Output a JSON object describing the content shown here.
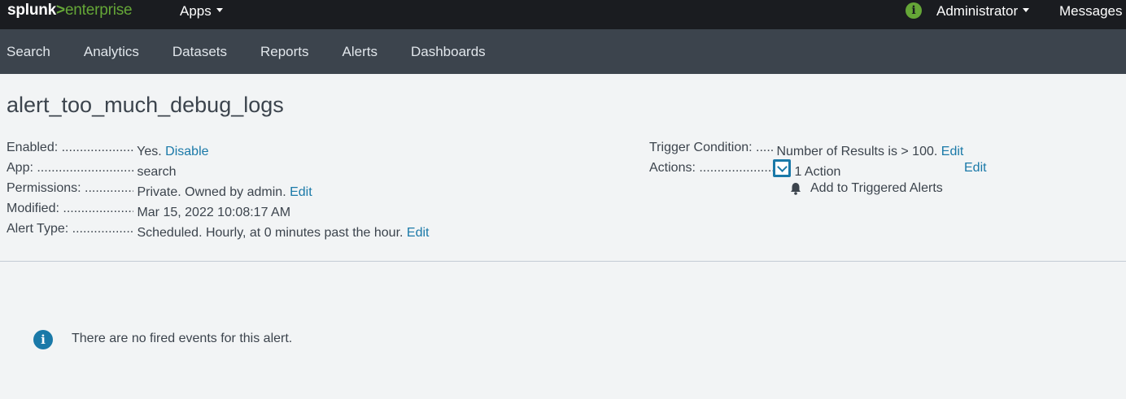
{
  "header": {
    "logo_brand": "splunk",
    "logo_gt": ">",
    "logo_product": "enterprise",
    "apps_label": "Apps",
    "user_label": "Administrator",
    "messages_label": "Messages",
    "status_icon": "i"
  },
  "nav": {
    "items": [
      "Search",
      "Analytics",
      "Datasets",
      "Reports",
      "Alerts",
      "Dashboards"
    ]
  },
  "alert": {
    "name": "alert_too_much_debug_logs",
    "details": [
      {
        "key": "Enabled: ........................................",
        "value": "Yes.",
        "link": "Disable"
      },
      {
        "key": "App: ..................................................",
        "value": "search",
        "link": ""
      },
      {
        "key": "Permissions: ........................................",
        "value": "Private. Owned by admin.",
        "link": "Edit"
      },
      {
        "key": "Modified: ........................................",
        "value": "Mar 15, 2022 10:08:17 AM",
        "link": ""
      },
      {
        "key": "Alert Type: ........................................",
        "value": "Scheduled. Hourly, at 0 minutes past the hour.",
        "link": "Edit"
      }
    ],
    "trigger_key": "Trigger Condition: ........................",
    "trigger_value": "Number of Results is > 100.",
    "trigger_link": "Edit",
    "actions_key": "Actions: ........................................",
    "actions_value": "1 Action",
    "actions_link": "Edit",
    "action_item": "Add to Triggered Alerts"
  },
  "events": {
    "info_icon": "i",
    "empty_message": "There are no fired events for this alert."
  },
  "colors": {
    "topbar": "#1a1c20",
    "appbar": "#3c444d",
    "accent_green": "#65a637",
    "link_blue": "#1a79a8",
    "page_bg": "#f2f4f5"
  }
}
